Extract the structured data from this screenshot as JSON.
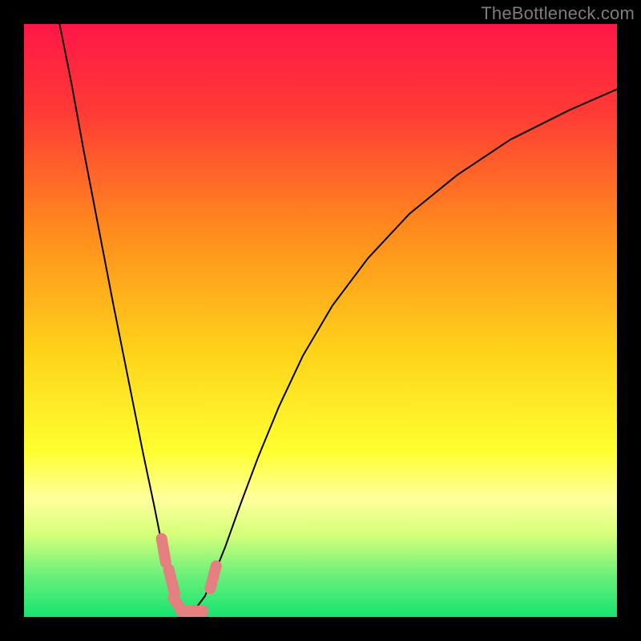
{
  "watermark": "TheBottleneck.com",
  "chart_data": {
    "type": "line",
    "title": "",
    "xlabel": "",
    "ylabel": "",
    "xlim": [
      0,
      100
    ],
    "ylim": [
      0,
      100
    ],
    "grid": false,
    "legend": false,
    "background_gradient": {
      "stops": [
        {
          "offset": 0.0,
          "color": "#ff1747"
        },
        {
          "offset": 0.15,
          "color": "#ff3b35"
        },
        {
          "offset": 0.35,
          "color": "#ff8c1d"
        },
        {
          "offset": 0.55,
          "color": "#ffd21a"
        },
        {
          "offset": 0.72,
          "color": "#ffff30"
        },
        {
          "offset": 0.8,
          "color": "#ffff9c"
        },
        {
          "offset": 0.86,
          "color": "#d6ff7a"
        },
        {
          "offset": 0.93,
          "color": "#6af07a"
        },
        {
          "offset": 1.0,
          "color": "#15e470"
        }
      ]
    },
    "series": [
      {
        "name": "bottleneck-curve",
        "stroke": "#000000",
        "stroke_width": 2,
        "x": [
          6.0,
          8.0,
          10.0,
          12.5,
          15.0,
          17.5,
          20.0,
          22.0,
          23.5,
          24.8,
          26.0,
          27.0,
          28.0,
          29.0,
          30.5,
          32.0,
          34.0,
          36.5,
          39.5,
          43.0,
          47.0,
          52.0,
          58.0,
          65.0,
          73.0,
          82.0,
          92.0,
          100.0
        ],
        "y": [
          100.0,
          90.0,
          79.0,
          66.0,
          53.0,
          40.5,
          28.0,
          18.5,
          11.0,
          5.5,
          2.0,
          1.0,
          1.0,
          1.5,
          3.5,
          7.0,
          12.0,
          19.0,
          27.0,
          35.5,
          44.0,
          52.5,
          60.5,
          68.0,
          74.5,
          80.5,
          85.5,
          89.0
        ]
      },
      {
        "name": "markers-cluster",
        "type": "segments",
        "stroke": "#e48080",
        "stroke_width": 14,
        "linecap": "round",
        "segments": [
          {
            "x1": 23.2,
            "y1": 13.2,
            "x2": 23.9,
            "y2": 9.2
          },
          {
            "x1": 24.4,
            "y1": 8.0,
            "x2": 25.4,
            "y2": 4.0
          },
          {
            "x1": 25.2,
            "y1": 3.2,
            "x2": 26.4,
            "y2": 1.4
          },
          {
            "x1": 26.5,
            "y1": 1.0,
            "x2": 30.2,
            "y2": 1.0
          },
          {
            "x1": 31.4,
            "y1": 4.8,
            "x2": 32.4,
            "y2": 8.6
          }
        ]
      }
    ]
  }
}
